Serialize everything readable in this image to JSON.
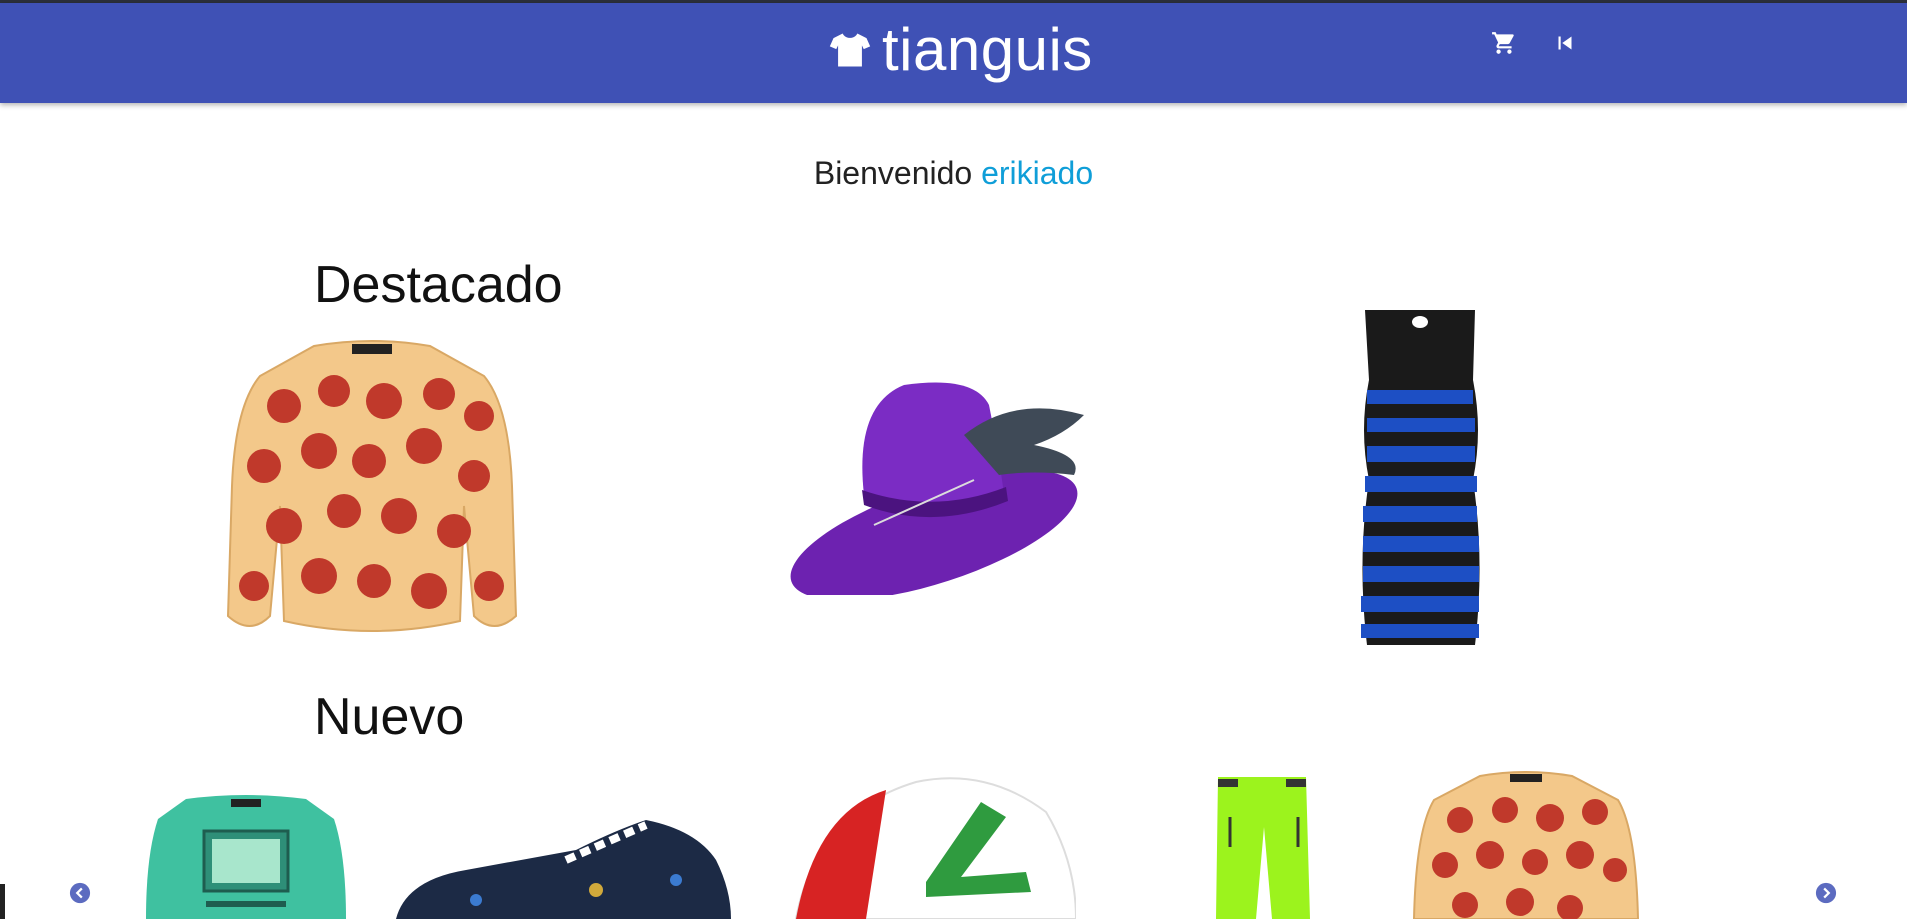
{
  "header": {
    "brand": "tianguis",
    "brand_icon": "tshirt-icon",
    "background": "#3f51b5",
    "actions": [
      {
        "name": "cart",
        "icon": "shopping-cart-icon"
      },
      {
        "name": "logout",
        "icon": "skip-previous-icon"
      }
    ]
  },
  "welcome": {
    "greeting": "Bienvenido",
    "username": "erikiado",
    "link_color": "#0f9ed8"
  },
  "featured": {
    "title": "Destacado",
    "items": [
      {
        "alt": "pepperoni pizza sweater"
      },
      {
        "alt": "purple feathered hat"
      },
      {
        "alt": "blue and black dress"
      }
    ]
  },
  "new": {
    "title": "Nuevo",
    "items": [
      {
        "alt": "game over sweater"
      },
      {
        "alt": "navy sneaker"
      },
      {
        "alt": "trucker cap"
      },
      {
        "alt": "neon green ski pants"
      },
      {
        "alt": "pepperoni pizza sweater"
      }
    ]
  },
  "carousel": {
    "prev_icon": "chevron-left-circle-icon",
    "next_icon": "chevron-right-circle-icon"
  }
}
